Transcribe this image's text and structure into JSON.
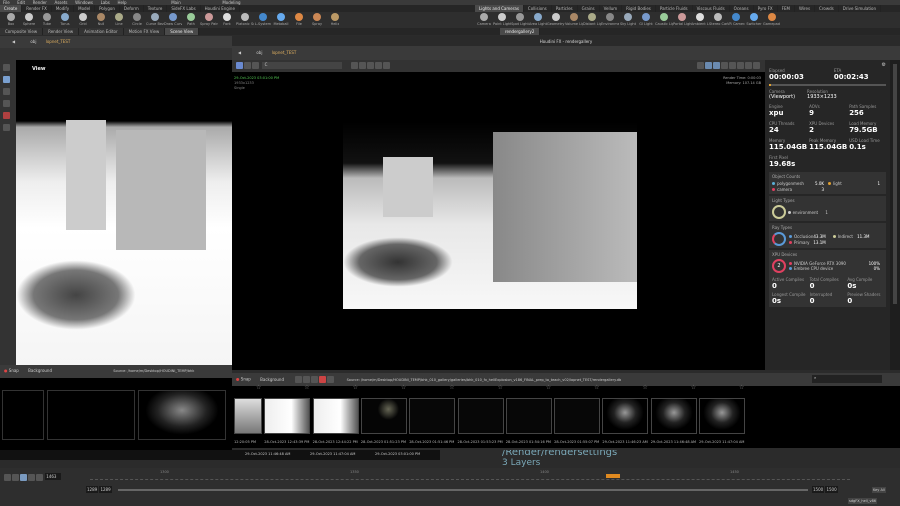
{
  "menu": {
    "items": [
      "File",
      "Edit",
      "Render",
      "Assets",
      "Windows",
      "Labs",
      "Help"
    ],
    "desktop": "Modeling",
    "build": "Main"
  },
  "shelf_left": {
    "tabs": [
      "Create",
      "Render FX",
      "Modify",
      "Model",
      "Polygon",
      "Deform",
      "Texture",
      "SideFX Labs",
      "Houdini Engine"
    ],
    "tools": [
      "Box",
      "Sphere",
      "Tube",
      "Torus",
      "Grid",
      "Null",
      "Line",
      "Circle",
      "Curve Bezier",
      "Draw Curve",
      "Path",
      "Spray Paint",
      "Font",
      "Platonic Solids",
      "L-System",
      "Metaball",
      "File",
      "Spray",
      "Helix"
    ]
  },
  "shelf_right": {
    "tabs": [
      "Lights and Cameras",
      "Collisions",
      "Particles",
      "Grains",
      "Vellum",
      "Rigid Bodies",
      "Particle Fluids",
      "Viscous Fluids",
      "Oceans",
      "Pyro FX",
      "FEM",
      "Wires",
      "Crowds",
      "Drive Simulation"
    ],
    "tools": [
      "Camera",
      "Point Light",
      "Spot Light",
      "Area Light",
      "Geometry Light",
      "Volume Light",
      "Distant Light",
      "Environment Light",
      "Sky Light",
      "GI Light",
      "Caustic Light",
      "Portal Light",
      "Ambient Light",
      "Stereo Camera",
      "VR Camera",
      "Switcher",
      "Gamepad Camera"
    ]
  },
  "pane_tabs_left": [
    "Composite View",
    "Render View",
    "Animation Editor",
    "Motion FX View",
    "Scene View"
  ],
  "pane_tabs_right": [
    "rendergallery2"
  ],
  "left_view": {
    "path": [
      "obj",
      "lopnet_TEST"
    ],
    "label": "View"
  },
  "render_window": {
    "title": "Houdini FX - rendergallery",
    "path": [
      "obj",
      "lopnet_TEST"
    ],
    "camera_field": "C",
    "timestamp": "29-Oct-2023 03:01:00 PM",
    "resolution": "1933x1233",
    "mode": "Single",
    "render_time": "Render Time: 0:00:03",
    "memory": "Memory:   107.14 GB"
  },
  "stats": {
    "elapsed_label": "Elapsed",
    "elapsed": "00:00:03",
    "eta_label": "ETA",
    "eta": "00:02:43",
    "progress": 0.02,
    "camera_label": "Camera",
    "camera": "(Viewport)",
    "resolution_label": "Resolution",
    "resolution": "1933×1233",
    "cells": [
      {
        "label": "Engine",
        "value": "xpu"
      },
      {
        "label": "AOVs",
        "value": "9"
      },
      {
        "label": "Path Samples",
        "value": "256"
      },
      {
        "label": "CPU Threads",
        "value": "24"
      },
      {
        "label": "XPU Devices",
        "value": "2"
      },
      {
        "label": "Load Memory",
        "value": "79.5GB"
      },
      {
        "label": "Memory",
        "value": "115.04GB"
      },
      {
        "label": "Peak Memory",
        "value": "115.04GB"
      },
      {
        "label": "USD Load Time",
        "value": "0.1s"
      },
      {
        "label": "First Pixel",
        "value": "19.68s"
      }
    ],
    "object_counts": {
      "title": "Object Counts",
      "items": [
        {
          "name": "polygonmesh",
          "value": "5.0K",
          "color": "#5ab0d8"
        },
        {
          "name": "light",
          "value": "1",
          "color": "#e0a030"
        },
        {
          "name": "camera",
          "value": "3",
          "color": "#e04060"
        }
      ]
    },
    "light_types": {
      "title": "Light Types",
      "items": [
        {
          "name": "environment",
          "value": "1"
        }
      ]
    },
    "ray_types": {
      "title": "Ray Types",
      "items": [
        {
          "name": "Occlusion",
          "value": "43.3M",
          "color": "#5a9ad8"
        },
        {
          "name": "Indirect",
          "value": "11.3M",
          "color": "#cccc99"
        },
        {
          "name": "Primary",
          "value": "13.1M",
          "color": "#e04060"
        }
      ]
    },
    "xpu_devices": {
      "title": "XPU Devices",
      "count": "2",
      "items": [
        {
          "name": "NVIDIA GeForce RTX 3090",
          "value": "100%",
          "color": "#e04060"
        },
        {
          "name": "Embree CPU device",
          "value": "0%",
          "color": "#5a9ad8"
        }
      ]
    },
    "compile": [
      {
        "label": "Active Compiles",
        "value": "0"
      },
      {
        "label": "Total Compiles",
        "value": "0"
      },
      {
        "label": "Avg Compile",
        "value": "0s"
      },
      {
        "label": "Longest Compile",
        "value": "0s"
      },
      {
        "label": "Interrupted",
        "value": "0"
      },
      {
        "label": "Preview Shaders",
        "value": "0"
      }
    ]
  },
  "gallery": {
    "snap": "Snap",
    "background": "Background",
    "source": "Source: /home/m/Desktop/HOUDINI_TEMP/bhk_010_gallery/galleries/bhk_010_fx_hellExplosion_v186_FINAL_prep_to_teach_v02/lopnet_TEST/rendergallery.db",
    "timestamps": [
      "12:20:05 PM",
      "28-Oct-2023 12:43:39 PM",
      "28-Oct-2023 12:44:22 PM",
      "28-Oct-2023 01:51:23 PM",
      "28-Oct-2023 01:51:46 PM",
      "28-Oct-2023 01:53:23 PM",
      "28-Oct-2023 01:54:16 PM",
      "28-Oct-2023 01:55:07 PM",
      "29-Oct-2023 11:46:23 AM",
      "29-Oct-2023 11:46:48 AM",
      "29-Oct-2023 11:47:04 AM"
    ]
  },
  "left_gallery": {
    "source": "Source: /home/m/Desktop/HOUDINI_TEMP/bhk",
    "timestamps": [
      "1:54:16 PM",
      "28-Oct-2023 01:55:07 PM",
      "29-Oct-2023 11:46:23 AM"
    ],
    "timestamps2": [
      "29-Oct-2023 11:46:48 AM",
      "29-Oct-2023 11:47:04 AM",
      "29-Oct-2023 03:01:00 PM"
    ]
  },
  "overlay": {
    "line1": "/Render/rendersettings",
    "line2": "3 Layers"
  },
  "timeline": {
    "frame": "1463",
    "start": "1289",
    "start2": "1289",
    "end": "1500",
    "end2": "1500",
    "ticks": [
      "1300",
      "1350",
      "1400",
      "1450",
      "1500"
    ],
    "scene": "sdgFX_hell_v86",
    "keys": "Key All"
  }
}
